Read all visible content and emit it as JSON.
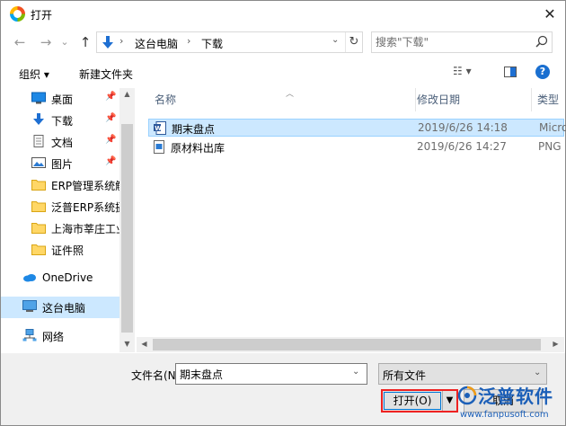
{
  "window": {
    "title": "打开"
  },
  "nav": {
    "back": "←",
    "forward": "→",
    "up": "↑",
    "recent": "⌄"
  },
  "address": {
    "path": [
      "这台电脑",
      "下载"
    ],
    "separator": "›",
    "dropdown": "⌄",
    "refresh": "↻"
  },
  "search": {
    "placeholder": "搜索\"下载\""
  },
  "toolbar": {
    "organize": "组织 ▾",
    "new_folder": "新建文件夹",
    "view": "☷ ▾",
    "help": "?"
  },
  "sidebar": {
    "items": [
      {
        "label": "桌面",
        "icon": "desktop-icon",
        "pinned": true
      },
      {
        "label": "下载",
        "icon": "download-icon",
        "pinned": true
      },
      {
        "label": "文档",
        "icon": "document-icon",
        "pinned": true
      },
      {
        "label": "图片",
        "icon": "pictures-icon",
        "pinned": true
      },
      {
        "label": "ERP管理系统解",
        "icon": "folder-icon",
        "pinned": false
      },
      {
        "label": "泛普ERP系统摄",
        "icon": "folder-icon",
        "pinned": false
      },
      {
        "label": "上海市莘庄工业",
        "icon": "folder-icon",
        "pinned": false
      },
      {
        "label": "证件照",
        "icon": "folder-icon",
        "pinned": false
      },
      {
        "label": "OneDrive",
        "icon": "onedrive-icon",
        "pinned": false
      },
      {
        "label": "这台电脑",
        "icon": "computer-icon",
        "pinned": false,
        "selected": true
      },
      {
        "label": "网络",
        "icon": "network-icon",
        "pinned": false
      }
    ],
    "pin_glyph": "📌"
  },
  "columns": {
    "name": "名称",
    "modified": "修改日期",
    "type": "类型"
  },
  "files": [
    {
      "name": "期末盘点",
      "modified": "2019/6/26 14:18",
      "type": "Micro",
      "icon": "word-doc-icon",
      "selected": true
    },
    {
      "name": "原材料出库",
      "modified": "2019/6/26 14:27",
      "type": "PNG",
      "icon": "image-file-icon",
      "selected": false
    }
  ],
  "bottom": {
    "filename_label": "文件名(N):",
    "filename_value": "期末盘点",
    "filter_value": "所有文件",
    "open_label": "打开(O)",
    "open_split": "▼",
    "cancel_label": "取消"
  },
  "watermark": {
    "name": "泛普软件",
    "url": "www.fanpusoft.com"
  },
  "colors": {
    "selection": "#cce8ff",
    "accent": "#0078d7",
    "highlight_border": "#e22222",
    "brand": "#1b5fb8"
  }
}
